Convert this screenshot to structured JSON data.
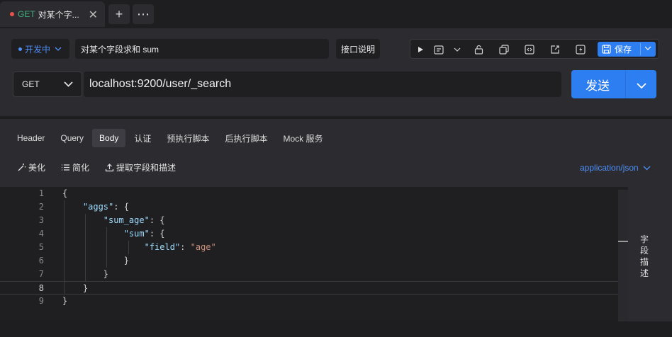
{
  "tab": {
    "method": "GET",
    "title": "对某个字...",
    "close": "✕"
  },
  "tab_actions": {
    "add": "+",
    "more": "⋯"
  },
  "request": {
    "status_label": "开发中",
    "name": "对某个字段求和 sum",
    "doc_label": "接口说明",
    "save_label": "保存",
    "method": "GET",
    "url": "localhost:9200/user/_search",
    "send_label": "发送"
  },
  "body_tabs": [
    "Header",
    "Query",
    "Body",
    "认证",
    "预执行脚本",
    "后执行脚本",
    "Mock 服务"
  ],
  "active_body_tab": "Body",
  "body_tools": {
    "beautify": "美化",
    "simplify": "简化",
    "extract": "提取字段和描述"
  },
  "content_type": "application/json",
  "field_desc_label": "字段描述",
  "code_lines": [
    {
      "n": "1",
      "text": "{"
    },
    {
      "n": "2",
      "text": "    \"aggs\": {"
    },
    {
      "n": "3",
      "text": "        \"sum_age\": {"
    },
    {
      "n": "4",
      "text": "            \"sum\": {"
    },
    {
      "n": "5",
      "text": "                \"field\": \"age\""
    },
    {
      "n": "6",
      "text": "            }"
    },
    {
      "n": "7",
      "text": "        }"
    },
    {
      "n": "8",
      "text": "    }"
    },
    {
      "n": "9",
      "text": "}"
    }
  ],
  "current_line": "8",
  "colors": {
    "accent": "#2d7ef0",
    "status": "#4f8ff7",
    "get_method": "#3fb27f",
    "unsaved_dot": "#e5534b"
  }
}
